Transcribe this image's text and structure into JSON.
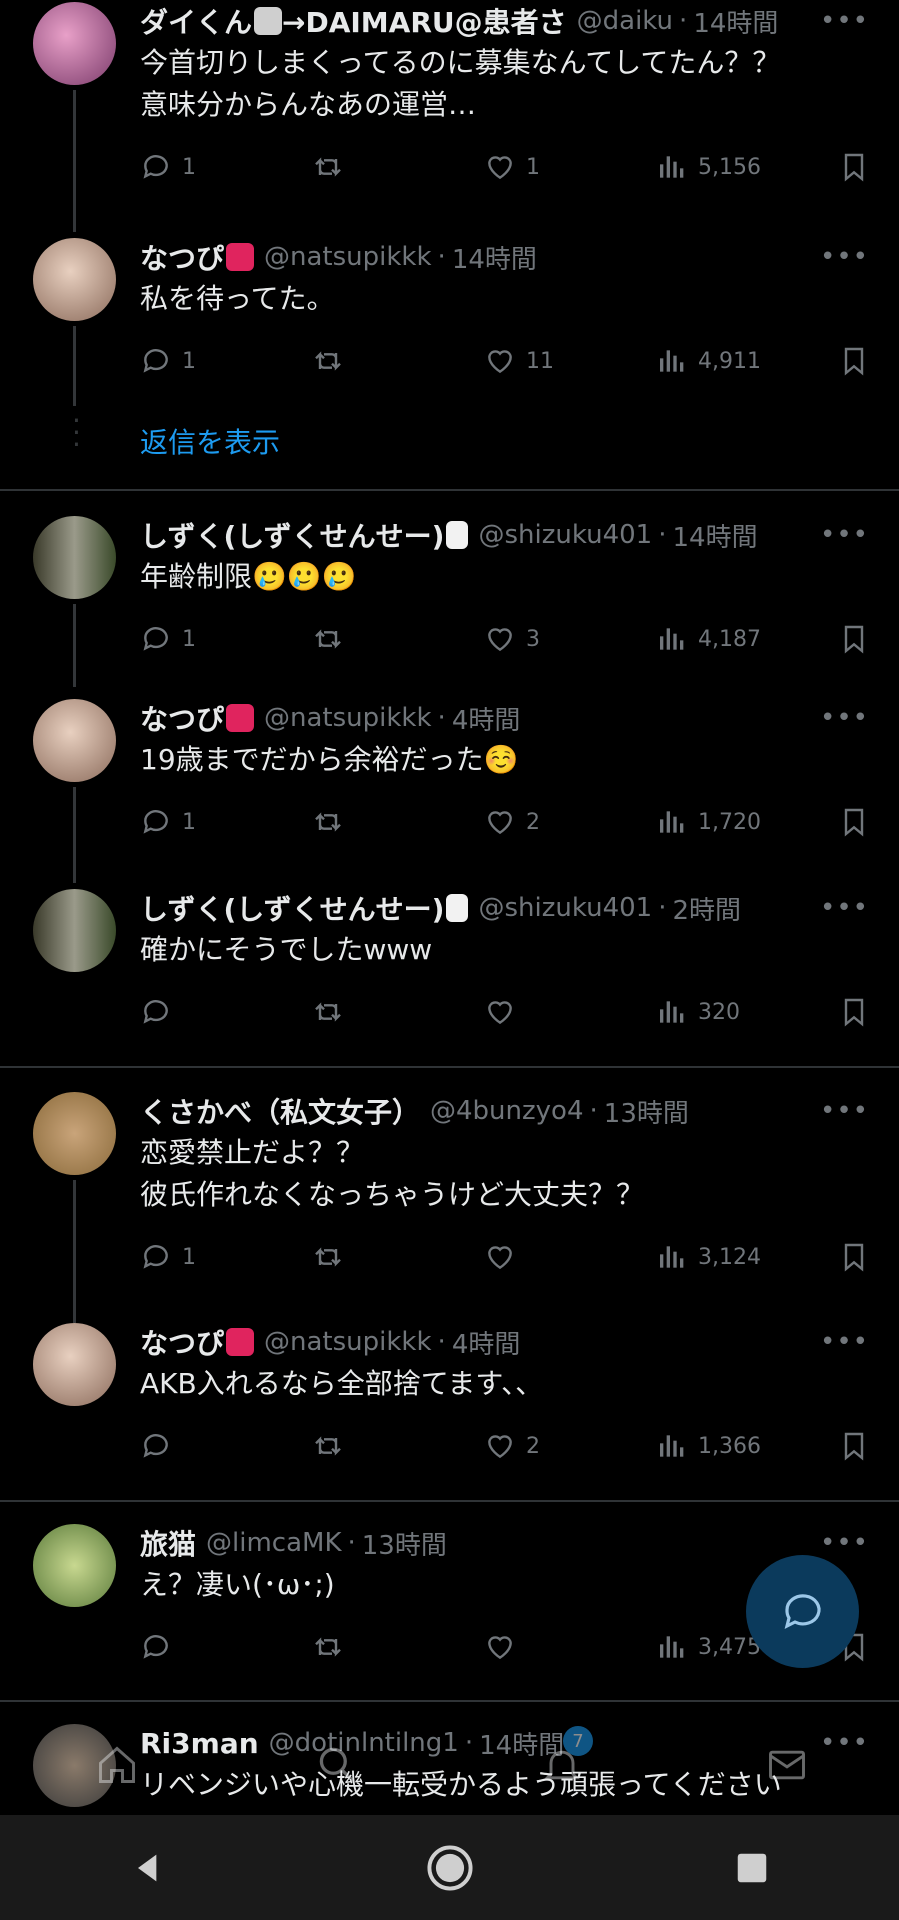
{
  "tweets": [
    {
      "name": "ダイくん",
      "name_suffix": "→DAIMARU@患者さ",
      "handle": "@daiku",
      "time": "14時間",
      "text": "今首切りしまくってるのに募集なんてしてたん？？\n意味分からんなあの運営…",
      "reply": "1",
      "retweet": "",
      "like": "1",
      "views": "5,156",
      "emoji": "cow"
    },
    {
      "name": "なつぴ",
      "name_suffix": "",
      "handle": "@natsupikkk",
      "time": "14時間",
      "text": "私を待ってた。",
      "reply": "1",
      "retweet": "",
      "like": "11",
      "views": "4,911",
      "emoji": "heart"
    },
    {
      "name": "しずく(しずくせんせー)",
      "name_suffix": "",
      "handle": "@shizuku401",
      "time": "14時間",
      "text": "年齢制限🥲🥲🥲",
      "reply": "1",
      "retweet": "",
      "like": "3",
      "views": "4,187",
      "emoji": "tooth"
    },
    {
      "name": "なつぴ",
      "name_suffix": "",
      "handle": "@natsupikkk",
      "time": "4時間",
      "text": "19歳までだから余裕だった☺️",
      "reply": "1",
      "retweet": "",
      "like": "2",
      "views": "1,720",
      "emoji": "heart"
    },
    {
      "name": "しずく(しずくせんせー)",
      "name_suffix": "",
      "handle": "@shizuku401",
      "time": "2時間",
      "text": "確かにそうでしたwww",
      "reply": "",
      "retweet": "",
      "like": "",
      "views": "320",
      "emoji": "tooth"
    },
    {
      "name": "くさかべ（私文女子）",
      "name_suffix": "",
      "handle": "@4bunzyo4",
      "time": "13時間",
      "text": "恋愛禁止だよ？？\n彼氏作れなくなっちゃうけど大丈夫？？",
      "reply": "1",
      "retweet": "",
      "like": "",
      "views": "3,124",
      "emoji": ""
    },
    {
      "name": "なつぴ",
      "name_suffix": "",
      "handle": "@natsupikkk",
      "time": "4時間",
      "text": "AKB入れるなら全部捨てます、、",
      "reply": "",
      "retweet": "",
      "like": "2",
      "views": "1,366",
      "emoji": "heart"
    },
    {
      "name": "旅猫",
      "name_suffix": "",
      "handle": "@limcaMK",
      "time": "13時間",
      "text": "え？凄い(･ω･;)",
      "reply": "",
      "retweet": "",
      "like": "",
      "views": "3,475",
      "emoji": ""
    },
    {
      "name": "Ri3man",
      "name_suffix": "",
      "handle": "@dotinlntilng1",
      "time": "14時間",
      "text": "リベンジいや心機一転受かるよう頑張ってください",
      "reply": "",
      "retweet": "",
      "like": "",
      "views": "",
      "emoji": ""
    }
  ],
  "show_replies_label": "返信を表示",
  "separator": "·",
  "notification_badge": "7",
  "colors": {
    "accent": "#1d9bf0",
    "muted": "#71767b",
    "text": "#e7e9ea",
    "background": "#000000",
    "fab": "#0b3a5c"
  },
  "icons": {
    "reply": "reply-icon",
    "retweet": "retweet-icon",
    "like": "like-icon",
    "views": "views-icon",
    "bookmark": "bookmark-icon",
    "more": "more-icon",
    "fab": "compose-reply-icon",
    "nav": [
      "back-icon",
      "home-icon",
      "recents-icon"
    ]
  }
}
